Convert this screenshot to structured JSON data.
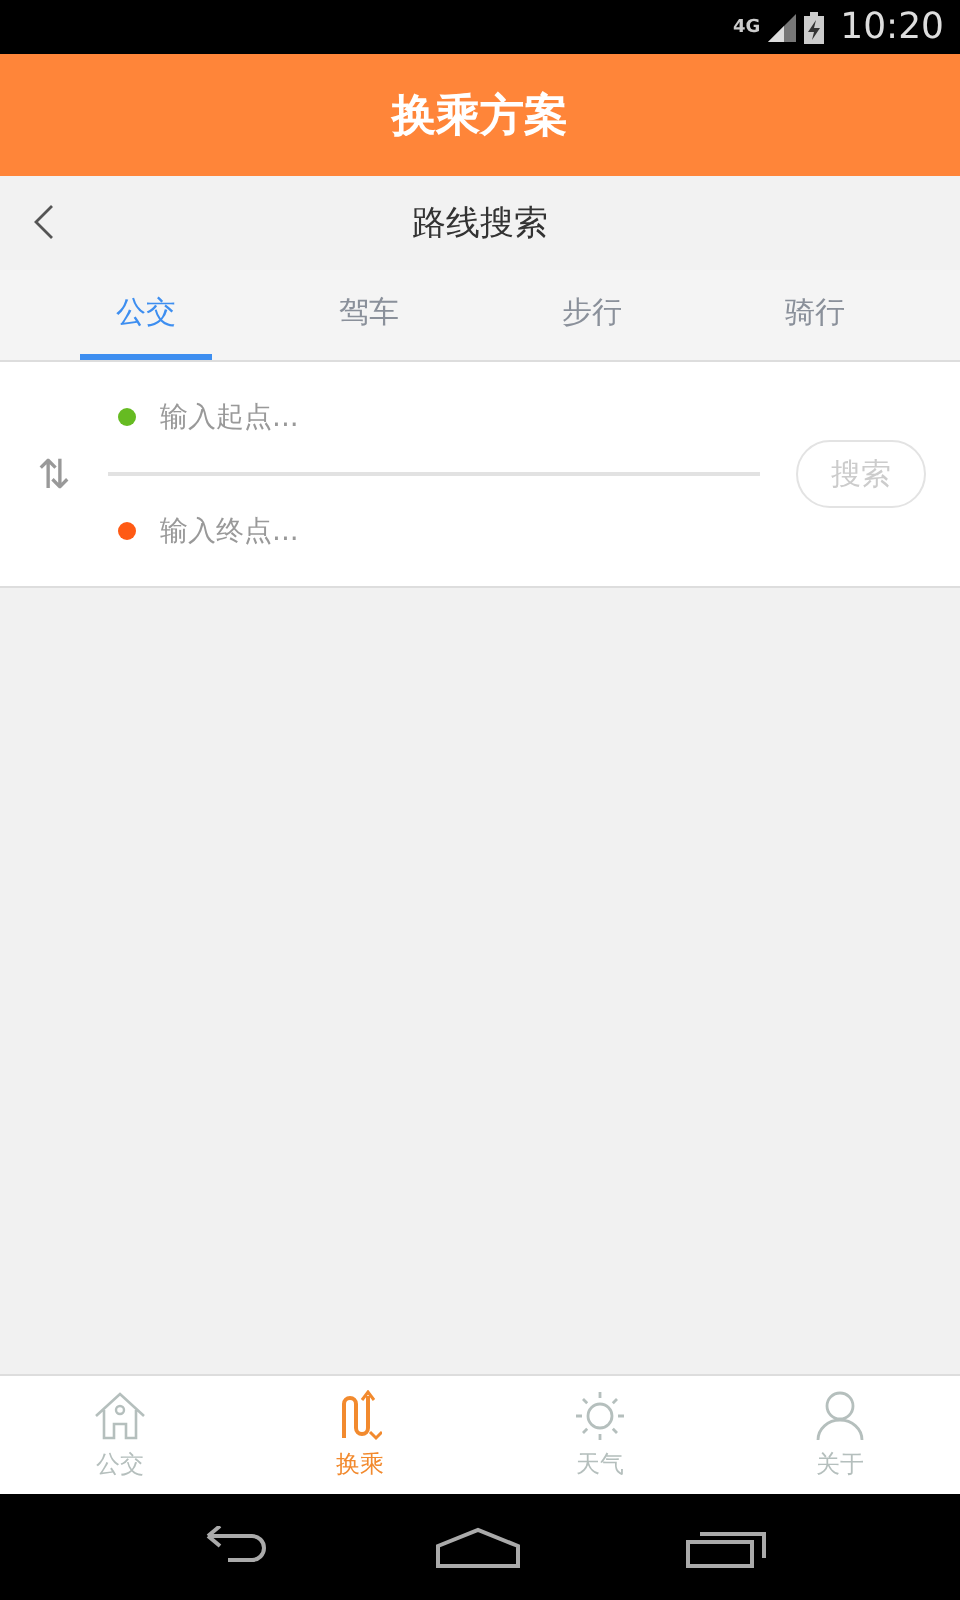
{
  "status_bar": {
    "network": "4G",
    "time": "10:20"
  },
  "app_bar": {
    "title": "换乘方案"
  },
  "sub_header": {
    "title": "路线搜索"
  },
  "tabs": [
    {
      "label": "公交",
      "selected": true
    },
    {
      "label": "驾车",
      "selected": false
    },
    {
      "label": "步行",
      "selected": false
    },
    {
      "label": "骑行",
      "selected": false
    }
  ],
  "route_form": {
    "start": {
      "placeholder": "输入起点...",
      "color": "#66bb22"
    },
    "end": {
      "placeholder": "输入终点...",
      "color": "#ff5a14"
    },
    "swap_icon": "⇅",
    "search_button": {
      "label": "搜索",
      "disabled": true
    }
  },
  "bottom_nav": [
    {
      "label": "公交",
      "kind": "home",
      "selected": false
    },
    {
      "label": "换乘",
      "kind": "transfer",
      "selected": true
    },
    {
      "label": "天气",
      "kind": "weather",
      "selected": false
    },
    {
      "label": "关于",
      "kind": "about",
      "selected": false
    }
  ]
}
